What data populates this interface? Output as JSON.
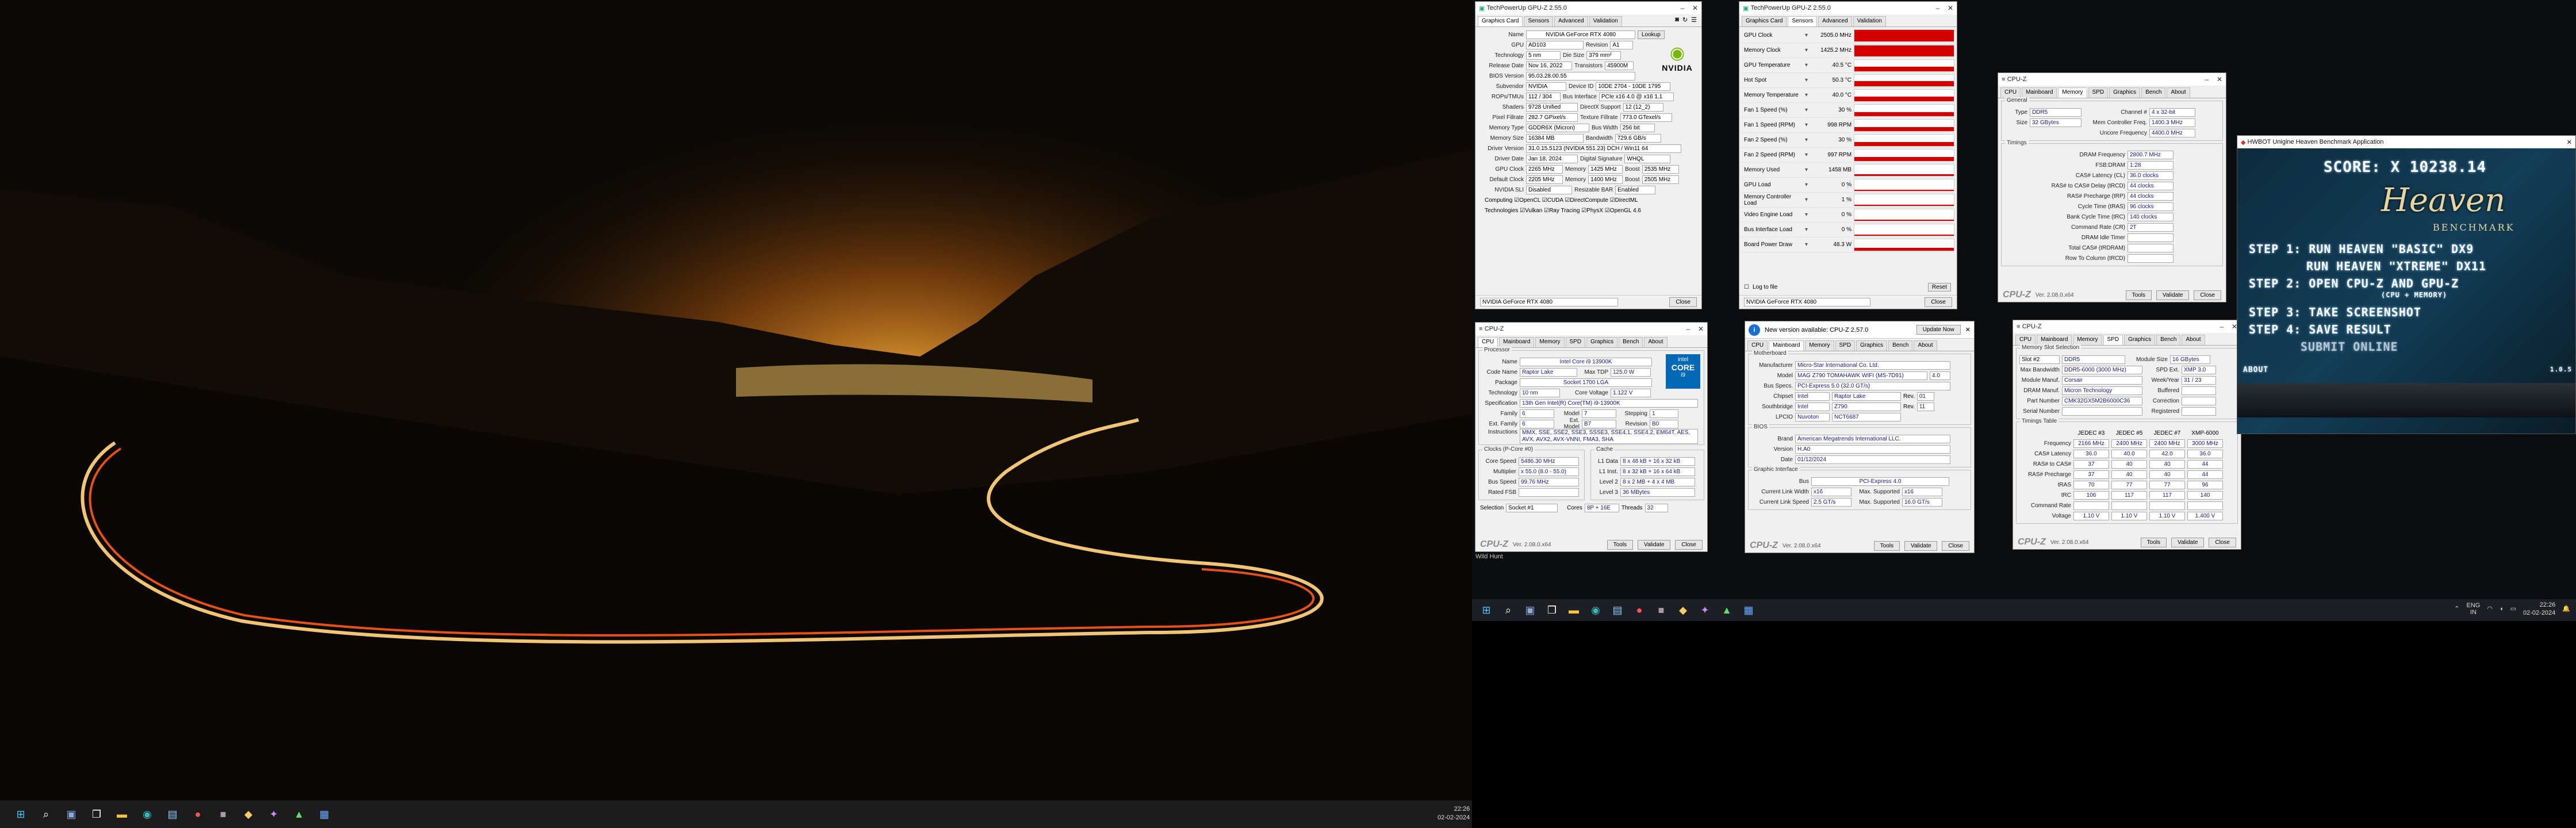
{
  "taskbar_left": {
    "time": "22:26",
    "date": "02-02-2024"
  },
  "taskbar_right": {
    "lang": "ENG",
    "lang2": "IN",
    "time": "22:26",
    "date": "02-02-2024"
  },
  "wild_hunt": "Wild Hunt",
  "gpuz1": {
    "title": "TechPowerUp GPU-Z 2.55.0",
    "tabs": [
      "Graphics Card",
      "Sensors",
      "Advanced",
      "Validation"
    ],
    "lookup": "Lookup",
    "fields": [
      [
        "Name",
        "NVIDIA GeForce RTX 4080"
      ],
      [
        "GPU",
        "AD103"
      ],
      [
        "Revision",
        "A1"
      ],
      [
        "Technology",
        "5 nm"
      ],
      [
        "Die Size",
        "379 mm²"
      ],
      [
        "Release Date",
        "Nov 16, 2022"
      ],
      [
        "Transistors",
        "45900M"
      ],
      [
        "BIOS Version",
        "95.03.28.00.55"
      ],
      [
        "Subvendor",
        "NVIDIA"
      ],
      [
        "Device ID",
        "10DE 2704 - 10DE 1795"
      ],
      [
        "ROPs/TMUs",
        "112 / 304"
      ],
      [
        "Bus Interface",
        "PCIe x16 4.0 @ x16 1.1"
      ],
      [
        "Shaders",
        "9728 Unified"
      ],
      [
        "DirectX Support",
        "12 (12_2)"
      ],
      [
        "Pixel Fillrate",
        "282.7 GPixel/s"
      ],
      [
        "Texture Fillrate",
        "773.0 GTexel/s"
      ],
      [
        "Memory Type",
        "GDDR6X (Micron)"
      ],
      [
        "Bus Width",
        "256 bit"
      ],
      [
        "Memory Size",
        "16384 MB"
      ],
      [
        "Bandwidth",
        "729.6 GB/s"
      ],
      [
        "Driver Version",
        "31.0.15.5123 (NVIDIA 551.23) DCH / Win11 64"
      ],
      [
        "Driver Date",
        "Jan 18, 2024"
      ],
      [
        "Digital Signature",
        "WHQL"
      ],
      [
        "GPU Clock",
        "2265 MHz"
      ],
      [
        "Memory",
        "1425 MHz"
      ],
      [
        "Boost",
        "2535 MHz"
      ],
      [
        "Default Clock",
        "2205 MHz"
      ],
      [
        "Memory",
        "1400 MHz"
      ],
      [
        "Boost",
        "2505 MHz"
      ],
      [
        "NVIDIA SLI",
        "Disabled"
      ],
      [
        "Resizable BAR",
        "Enabled"
      ]
    ],
    "computing": "Computing  ☑OpenCL ☑CUDA ☑DirectCompute ☑DirectML",
    "technologies": "Technologies ☑Vulkan ☑Ray Tracing ☑PhysX ☑OpenGL 4.6",
    "footer_select": "NVIDIA GeForce RTX 4080",
    "close": "Close",
    "nvidia": "NVIDIA"
  },
  "gpuz2": {
    "title": "TechPowerUp GPU-Z 2.55.0",
    "tabs": [
      "Graphics Card",
      "Sensors",
      "Advanced",
      "Validation"
    ],
    "sensors": [
      [
        "GPU Clock",
        "2505.0 MHz",
        0.9
      ],
      [
        "Memory Clock",
        "1425.2 MHz",
        0.85
      ],
      [
        "GPU Temperature",
        "40.5 °C",
        0.35
      ],
      [
        "Hot Spot",
        "50.3 °C",
        0.4
      ],
      [
        "Memory Temperature",
        "40.0 °C",
        0.35
      ],
      [
        "Fan 1 Speed (%)",
        "30 %",
        0.3
      ],
      [
        "Fan 1 Speed (RPM)",
        "998 RPM",
        0.3
      ],
      [
        "Fan 2 Speed (%)",
        "30 %",
        0.3
      ],
      [
        "Fan 2 Speed (RPM)",
        "997 RPM",
        0.3
      ],
      [
        "Memory Used",
        "1458 MB",
        0.1
      ],
      [
        "GPU Load",
        "0 %",
        0.05
      ],
      [
        "Memory Controller Load",
        "1 %",
        0.05
      ],
      [
        "Video Engine Load",
        "0 %",
        0.0
      ],
      [
        "Bus Interface Load",
        "0 %",
        0.0
      ],
      [
        "Board Power Draw",
        "48.3 W",
        0.2
      ]
    ],
    "log": "Log to file",
    "reset": "Reset",
    "footer_select": "NVIDIA GeForce RTX 4080",
    "close": "Close"
  },
  "cpuz_mem": {
    "title": "CPU-Z",
    "tabs": [
      "CPU",
      "Mainboard",
      "Memory",
      "SPD",
      "Graphics",
      "Bench",
      "About"
    ],
    "general": "General",
    "type_label": "Type",
    "type": "DDR5",
    "channel_label": "Channel #",
    "channel": "4 x 32-bit",
    "size_label": "Size",
    "size": "32 GBytes",
    "mc_label": "Mem Controller Freq.",
    "mc": "1400.3 MHz",
    "uncore_label": "Uncore Frequency",
    "uncore": "4400.0 MHz",
    "timings": "Timings",
    "rows": [
      [
        "DRAM Frequency",
        "2800.7 MHz"
      ],
      [
        "FSB:DRAM",
        "1:28"
      ],
      [
        "CAS# Latency (CL)",
        "36.0 clocks"
      ],
      [
        "RAS# to CAS# Delay (tRCD)",
        "44 clocks"
      ],
      [
        "RAS# Precharge (tRP)",
        "44 clocks"
      ],
      [
        "Cycle Time (tRAS)",
        "96 clocks"
      ],
      [
        "Bank Cycle Time (tRC)",
        "140 clocks"
      ],
      [
        "Command Rate (CR)",
        "2T"
      ],
      [
        "DRAM Idle Timer",
        ""
      ],
      [
        "Total CAS# (tRDRAM)",
        ""
      ],
      [
        "Row To Column (tRCD)",
        ""
      ]
    ],
    "ver": "Ver. 2.08.0.x64",
    "tools": "Tools",
    "validate": "Validate",
    "close": "Close",
    "logo": "CPU-Z"
  },
  "cpuz_cpu": {
    "title": "CPU-Z",
    "tabs": [
      "CPU",
      "Mainboard",
      "Memory",
      "SPD",
      "Graphics",
      "Bench",
      "About"
    ],
    "processor": "Processor",
    "rows": [
      [
        "Name",
        "Intel Core i9 13900K"
      ],
      [
        "Code Name",
        "Raptor Lake"
      ],
      [
        "Max TDP",
        "125.0 W"
      ],
      [
        "Package",
        "Socket 1700 LGA"
      ],
      [
        "Technology",
        "10 nm"
      ],
      [
        "Core Voltage",
        "1.122 V"
      ],
      [
        "Specification",
        "13th Gen Intel(R) Core(TM) i9-13900K"
      ],
      [
        "Family",
        "6"
      ],
      [
        "Model",
        "7"
      ],
      [
        "Stepping",
        "1"
      ],
      [
        "Ext. Family",
        "6"
      ],
      [
        "Ext. Model",
        "B7"
      ],
      [
        "Revision",
        "B0"
      ],
      [
        "Instructions",
        "MMX, SSE, SSE2, SSE3, SSSE3, SSE4.1, SSE4.2, EM64T, AES, AVX, AVX2, AVX-VNNI, FMA3, SHA"
      ]
    ],
    "clocks": "Clocks (P-Core #0)",
    "cache": "Cache",
    "clk": [
      [
        "Core Speed",
        "5486.30 MHz"
      ],
      [
        "Multiplier",
        "x 55.0 (8.0 - 55.0)"
      ],
      [
        "Bus Speed",
        "99.76 MHz"
      ],
      [
        "Rated FSB",
        ""
      ]
    ],
    "cch": [
      [
        "L1 Data",
        "8 x 48 kB + 16 x 32 kB"
      ],
      [
        "L1 Inst.",
        "8 x 32 kB + 16 x 64 kB"
      ],
      [
        "Level 2",
        "8 x 2 MB + 4 x 4 MB"
      ],
      [
        "Level 3",
        "36 MBytes"
      ]
    ],
    "selection": "Selection",
    "socket": "Socket #1",
    "cores": "Cores",
    "cores_val": "8P + 16E",
    "threads": "Threads",
    "threads_val": "32",
    "ver": "Ver. 2.08.0.x64",
    "tools": "Tools",
    "validate": "Validate",
    "close": "Close",
    "logo": "CPU-Z",
    "intel": "intel",
    "core": "CORE",
    "i9": "i9"
  },
  "cpuz_mb": {
    "title": "CPU-Z",
    "update_msg": "New version available: CPU-Z 2.57.0",
    "update_btn": "Update Now",
    "tabs": [
      "CPU",
      "Mainboard",
      "Memory",
      "SPD",
      "Graphics",
      "Bench",
      "About"
    ],
    "motherboard": "Motherboard",
    "rows": [
      [
        "Manufacturer",
        "Micro-Star International Co. Ltd."
      ],
      [
        "Model",
        "MAG Z790 TOMAHAWK WIFI (MS-7D91)",
        "4.0"
      ],
      [
        "Bus Specs.",
        "PCI-Express 5.0 (32.0 GT/s)"
      ],
      [
        "Chipset",
        "Intel",
        "Raptor Lake",
        "Rev.",
        "01"
      ],
      [
        "Southbridge",
        "Intel",
        "Z790",
        "Rev.",
        "11"
      ],
      [
        "LPCIO",
        "Nuvoton",
        "NCT6687"
      ]
    ],
    "bios": "BIOS",
    "bios_rows": [
      [
        "Brand",
        "American Megatrends International LLC."
      ],
      [
        "Version",
        "H.A0"
      ],
      [
        "Date",
        "01/12/2024"
      ]
    ],
    "gi": "Graphic Interface",
    "gi_rows": [
      [
        "Bus",
        "PCI-Express 4.0"
      ],
      [
        "Current Link Width",
        "x16",
        "Max. Supported",
        "x16"
      ],
      [
        "Current Link Speed",
        "2.5 GT/s",
        "Max. Supported",
        "16.0 GT/s"
      ]
    ],
    "ver": "Ver. 2.08.0.x64",
    "tools": "Tools",
    "validate": "Validate",
    "close": "Close",
    "logo": "CPU-Z"
  },
  "cpuz_spd": {
    "title": "CPU-Z",
    "tabs": [
      "CPU",
      "Mainboard",
      "Memory",
      "SPD",
      "Graphics",
      "Bench",
      "About"
    ],
    "slot_sel": "Memory Slot Selection",
    "slot": "Slot #2",
    "slot_type": "DDR5",
    "module_size_l": "Module Size",
    "module_size": "16 GBytes",
    "rows": [
      [
        "Max Bandwidth",
        "DDR5-6000 (3000 MHz)",
        "SPD Ext.",
        "XMP 3.0"
      ],
      [
        "Module Manuf.",
        "Corsair",
        "Week/Year",
        "31 / 23"
      ],
      [
        "DRAM Manuf.",
        "Micron Technology",
        "Buffered",
        ""
      ],
      [
        "Part Number",
        "CMK32GX5M2B6000C36",
        "Correction",
        ""
      ],
      [
        "Serial Number",
        "",
        "Registered",
        ""
      ]
    ],
    "timings_table": "Timings Table",
    "cols": [
      "",
      "JEDEC #3",
      "JEDEC #5",
      "JEDEC #7",
      "XMP-6000"
    ],
    "trows": [
      [
        "Frequency",
        "2166 MHz",
        "2400 MHz",
        "2400 MHz",
        "3000 MHz"
      ],
      [
        "CAS# Latency",
        "36.0",
        "40.0",
        "42.0",
        "36.0"
      ],
      [
        "RAS# to CAS#",
        "37",
        "40",
        "40",
        "44"
      ],
      [
        "RAS# Precharge",
        "37",
        "40",
        "40",
        "44"
      ],
      [
        "tRAS",
        "70",
        "77",
        "77",
        "96"
      ],
      [
        "tRC",
        "106",
        "117",
        "117",
        "140"
      ],
      [
        "Command Rate",
        "",
        "",
        "",
        ""
      ],
      [
        "Voltage",
        "1.10 V",
        "1.10 V",
        "1.10 V",
        "1.400 V"
      ]
    ],
    "ver": "Ver. 2.08.0.x64",
    "tools": "Tools",
    "validate": "Validate",
    "close": "Close",
    "logo": "CPU-Z"
  },
  "heaven": {
    "title": "HWBOT Unigine Heaven Benchmark Application",
    "score": "SCORE: X 10238.14",
    "brand": "Heaven",
    "benchmark": "BENCHMARK",
    "steps": [
      "STEP 1: RUN HEAVEN \"BASIC\" DX9",
      "RUN HEAVEN \"XTREME\" DX11",
      "STEP 2: OPEN CPU-Z AND GPU-Z",
      "(CPU + MEMORY)",
      "STEP 3: TAKE SCREENSHOT",
      "STEP 4: SAVE RESULT",
      "SUBMIT ONLINE"
    ],
    "about": "ABOUT",
    "version": "1.0.5"
  },
  "colors": {
    "accent": "#d40000",
    "intel_blue": "#0068b5",
    "nvidia_green": "#76b900"
  }
}
